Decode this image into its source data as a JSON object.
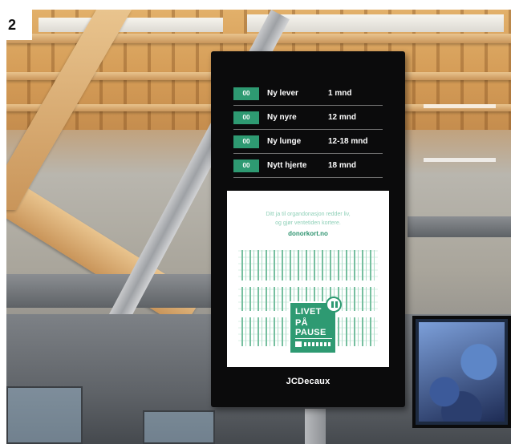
{
  "figure_label": "2",
  "sign": {
    "waiting_list": [
      {
        "count": "00",
        "organ": "Ny lever",
        "wait": "1 mnd"
      },
      {
        "count": "00",
        "organ": "Ny nyre",
        "wait": "12 mnd"
      },
      {
        "count": "00",
        "organ": "Ny lunge",
        "wait": "12-18 mnd"
      },
      {
        "count": "00",
        "organ": "Nytt hjerte",
        "wait": "18 mnd"
      }
    ],
    "ad": {
      "message_line1": "Ditt ja til organdonasjon redder liv,",
      "message_line2": "og gjør ventetiden kortere.",
      "url": "donorkort.no",
      "campaign_line1": "LIVET",
      "campaign_line2": "PÅ PAUSE"
    },
    "brand": "JCDecaux"
  },
  "colors": {
    "accent_green": "#2e9a72",
    "sign_background": "#0b0b0c",
    "wood": "#d39a55"
  }
}
